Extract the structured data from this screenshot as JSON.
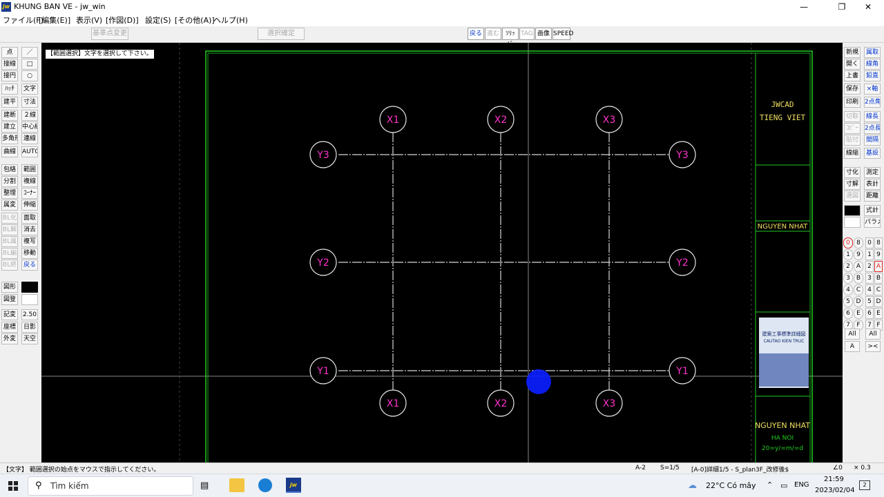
{
  "window": {
    "title": "KHUNG BAN VE - jw_win",
    "app_icon": "jw"
  },
  "menus": [
    "ファイル(F)",
    "[編集(E)]",
    "表示(V)",
    "[作図(D)]",
    "設定(S)",
    "[その他(A)]",
    "ヘルプ(H)"
  ],
  "toolbar": {
    "left_buttons": [
      "基準点変更",
      "選択確定"
    ],
    "right_buttons": [
      "戻る",
      "進む",
      "ｿﾘｯﾄﾞ",
      "TAG",
      "画像",
      "SPEED"
    ]
  },
  "left_tools": [
    [
      "点",
      "／"
    ],
    [
      "接線",
      "□"
    ],
    [
      "接円",
      "○"
    ],
    [
      "ﾊｯﾁ",
      "文字"
    ],
    [
      "建平",
      "寸法"
    ],
    [
      "建断",
      "２線"
    ],
    [
      "建立",
      "中心線"
    ],
    [
      "多角形",
      "連線"
    ],
    [
      "曲線",
      "AUTO"
    ],
    [
      "包絡",
      "範囲"
    ],
    [
      "分割",
      "複線"
    ],
    [
      "整理",
      "ｺｰﾅｰ"
    ],
    [
      "属変",
      "伸縮"
    ],
    [
      "BL化",
      "面取"
    ],
    [
      "BL解",
      "消去"
    ],
    [
      "BL属",
      "複写"
    ],
    [
      "BL編",
      "移動"
    ],
    [
      "BL終",
      "戻る"
    ],
    [
      "図形",
      ""
    ],
    [
      "図登",
      ""
    ],
    [
      "記変",
      "2.50"
    ],
    [
      "座標",
      "日影"
    ],
    [
      "外変",
      "天空"
    ]
  ],
  "right_tools": [
    [
      "新規",
      "属取"
    ],
    [
      "開く",
      "線角"
    ],
    [
      "上書",
      "鉛直"
    ],
    [
      "保存",
      "×軸"
    ],
    [
      "印刷",
      "2点角"
    ],
    [
      "切取",
      "線長"
    ],
    [
      "ｺﾋﾟｰ",
      "2点長"
    ],
    [
      "貼付",
      "間隔"
    ],
    [
      "線縮",
      "基設"
    ],
    [
      "寸化",
      "測定"
    ],
    [
      "寸解",
      "表計"
    ],
    [
      "選図",
      "距離"
    ],
    [
      "",
      "式計"
    ],
    [
      "",
      "パラメ"
    ]
  ],
  "layers": {
    "left": [
      "0",
      "1",
      "2",
      "3",
      "4",
      "5",
      "6",
      "7"
    ],
    "left_circled": [
      "8",
      "9",
      "A",
      "B",
      "C",
      "D",
      "E",
      "F"
    ],
    "right_a": [
      "0",
      "1",
      "2",
      "3",
      "4",
      "5",
      "6",
      "7"
    ],
    "right_b": [
      "8",
      "9",
      "A",
      "B",
      "C",
      "D",
      "E",
      "F"
    ],
    "all_label": "All",
    "bottom_left": "A",
    "bottom_right": "><"
  },
  "canvas": {
    "prompt": "【範囲選択】文字を選択して下さい。",
    "grid_bubbles": {
      "top": [
        "X1",
        "X2",
        "X3"
      ],
      "bottom": [
        "X1",
        "X2",
        "X3"
      ],
      "left": [
        "Y3",
        "Y2",
        "Y1"
      ],
      "right": [
        "Y3",
        "Y2",
        "Y1"
      ]
    },
    "title_block": {
      "line1": "JWCAD",
      "line2": "TIENG VIET",
      "author_top": "NGUYEN NHAT",
      "author_bottom": "NGUYEN NHAT",
      "city": "HA NOI",
      "date_field": "20=y/=m/=d",
      "thumb_title": "建築工事標準詳細図",
      "thumb_sub": "CAUTAO KIEN TRUC"
    },
    "colors": {
      "grid": "#d8d8d8",
      "bubble_text": "#ff33cc",
      "frame": "#22cc22",
      "cursor": "#0a1eff"
    }
  },
  "status": {
    "message": "【文字】 範囲選択の始点をマウスで指示してください。",
    "paper": "A-2",
    "scale": "S=1/5",
    "layer": "[A-0]詳細1/5 - S_plan3F_改修後$",
    "angle": "∠0",
    "factor": "× 0.3"
  },
  "taskbar": {
    "search_placeholder": "Tìm kiếm",
    "weather": "22°C  Có mây",
    "lang": "ENG",
    "time": "21:59",
    "date": "2023/02/04",
    "notif_count": "2"
  }
}
